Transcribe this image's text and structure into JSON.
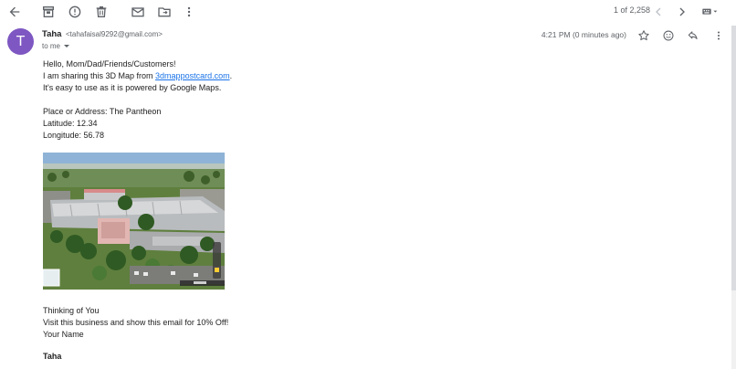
{
  "toolbar": {
    "back_icon": "arrow-left-icon",
    "archive_icon": "archive-icon",
    "spam_icon": "report-spam-icon",
    "delete_icon": "trash-icon",
    "unread_icon": "mark-unread-icon",
    "move_icon": "move-to-folder-icon",
    "more_icon": "more-vert-icon",
    "pager_text": "1 of 2,258",
    "prev_icon": "chevron-left-icon",
    "next_icon": "chevron-right-icon",
    "input_tools_icon": "keyboard-icon"
  },
  "message": {
    "avatar_letter": "T",
    "avatar_color": "#7e57c2",
    "sender_name": "Taha",
    "sender_email": "<tahafaisal9292@gmail.com>",
    "to_label": "to me",
    "timestamp": "4:21 PM (0 minutes ago)"
  },
  "body": {
    "greeting": "Hello, Mom/Dad/Friends/Customers!",
    "share_prefix": "I am sharing this 3D Map from ",
    "share_link": "3dmappostcard.com",
    "share_suffix": ".",
    "powered": "It's easy to use as it is powered by Google Maps.",
    "place": "Place or Address: The Pantheon",
    "latitude": "Latitude: 12.34",
    "longitude": "Longitude: 56.78",
    "thinking": "Thinking of You",
    "offer": "Visit this business and show this email for 10% Off!",
    "your_name": "Your Name",
    "signature": "Taha"
  },
  "colors": {
    "link": "#1a73e8",
    "icon": "#5f6368"
  }
}
